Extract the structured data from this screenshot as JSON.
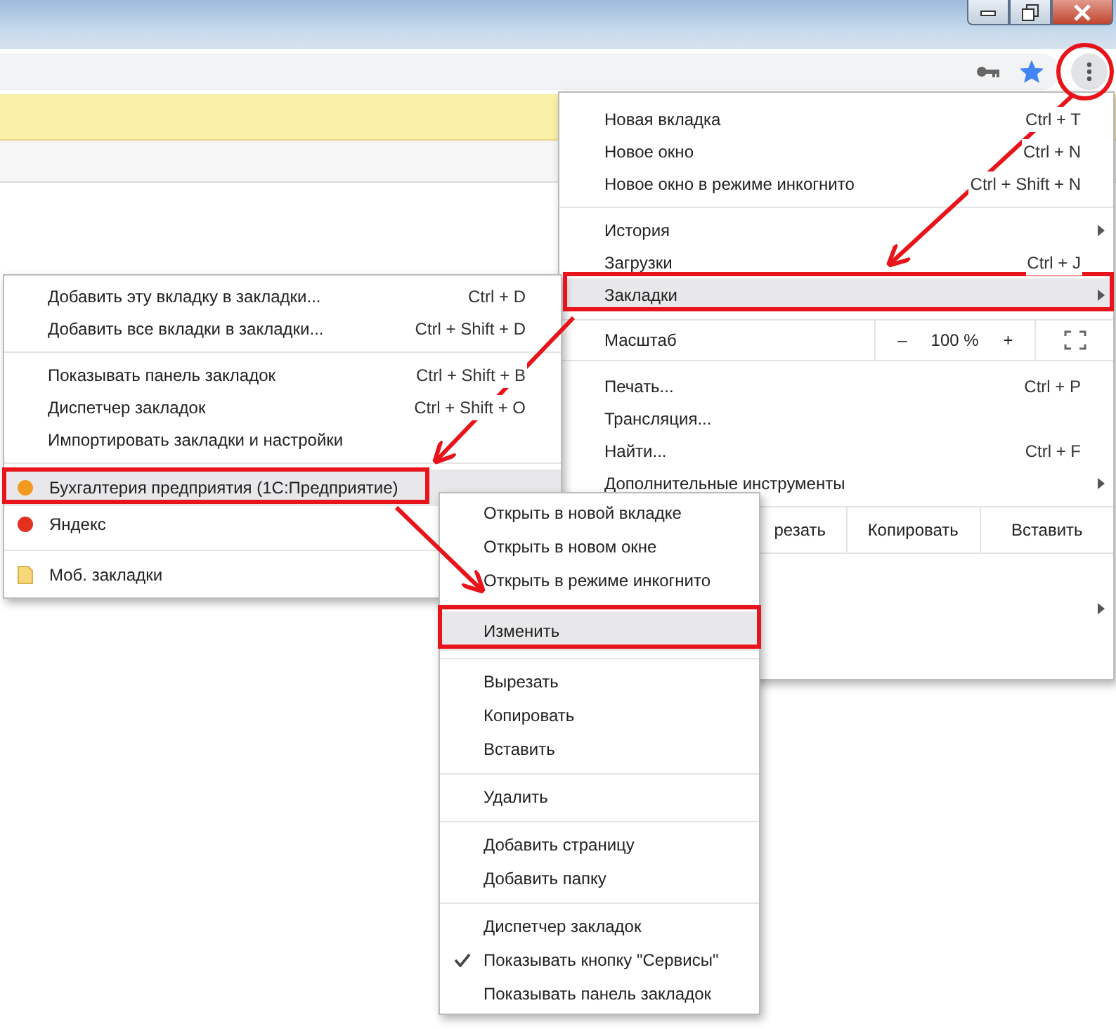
{
  "toolbar": {
    "bookmarked": true
  },
  "main_menu": [
    {
      "kind": "item",
      "label": "Новая вкладка",
      "shortcut": "Ctrl + T",
      "highlighted": false
    },
    {
      "kind": "item",
      "label": "Новое окно",
      "shortcut": "Ctrl + N",
      "highlighted": false
    },
    {
      "kind": "item",
      "label": "Новое окно в режиме инкогнито",
      "shortcut": "Ctrl + Shift + N",
      "highlighted": false
    },
    {
      "kind": "separator"
    },
    {
      "kind": "item",
      "label": "История",
      "has_submenu": true,
      "highlighted": false
    },
    {
      "kind": "item",
      "label": "Загрузки",
      "shortcut": "Ctrl + J",
      "highlighted": false
    },
    {
      "kind": "item",
      "label": "Закладки",
      "has_submenu": true,
      "highlighted": true
    },
    {
      "kind": "zoom",
      "label": "Масштаб",
      "minus": "–",
      "value": "100 %",
      "plus": "+"
    },
    {
      "kind": "item",
      "label": "Печать...",
      "shortcut": "Ctrl + P",
      "highlighted": false
    },
    {
      "kind": "item",
      "label": "Трансляция...",
      "highlighted": false
    },
    {
      "kind": "item",
      "label": "Найти...",
      "shortcut": "Ctrl + F",
      "highlighted": false
    },
    {
      "kind": "item",
      "label": "Дополнительные инструменты",
      "has_submenu": true,
      "highlighted": false
    },
    {
      "kind": "edit",
      "cells": [
        "резать",
        "Копировать",
        "Вставить"
      ]
    },
    {
      "kind": "item",
      "has_submenu": true,
      "highlighted": false
    }
  ],
  "bookmarks_menu": [
    {
      "kind": "item",
      "label": "Добавить эту вкладку в закладки...",
      "shortcut": "Ctrl + D",
      "highlighted": false
    },
    {
      "kind": "item",
      "label": "Добавить все вкладки в закладки...",
      "shortcut": "Ctrl + Shift + D",
      "highlighted": false
    },
    {
      "kind": "separator"
    },
    {
      "kind": "item",
      "label": "Показывать панель закладок",
      "shortcut": "Ctrl + Shift + B",
      "highlighted": false
    },
    {
      "kind": "item",
      "label": "Диспетчер закладок",
      "shortcut": "Ctrl + Shift + O",
      "highlighted": false
    },
    {
      "kind": "item",
      "label": "Импортировать закладки и настройки",
      "highlighted": false
    },
    {
      "kind": "separator"
    },
    {
      "kind": "link",
      "label": "Бухгалтерия предприятия (1С:Предприятие)",
      "color": "#f29a1f",
      "highlighted": true
    },
    {
      "kind": "link",
      "label": "Яндекс",
      "color": "#e3301f",
      "highlighted": false
    },
    {
      "kind": "separator"
    },
    {
      "kind": "folder",
      "label": "Моб. закладки",
      "highlighted": false
    }
  ],
  "context_menu": [
    {
      "kind": "item",
      "label": "Открыть в новой вкладке",
      "highlighted": false,
      "checked": false
    },
    {
      "kind": "item",
      "label": "Открыть в новом окне",
      "highlighted": false,
      "checked": false
    },
    {
      "kind": "item",
      "label": "Открыть в режиме инкогнито",
      "highlighted": false,
      "checked": false
    },
    {
      "kind": "separator"
    },
    {
      "kind": "item",
      "label": "Изменить",
      "highlighted": true,
      "checked": false
    },
    {
      "kind": "separator"
    },
    {
      "kind": "item",
      "label": "Вырезать",
      "highlighted": false,
      "checked": false
    },
    {
      "kind": "item",
      "label": "Копировать",
      "highlighted": false,
      "checked": false
    },
    {
      "kind": "item",
      "label": "Вставить",
      "highlighted": false,
      "checked": false
    },
    {
      "kind": "separator"
    },
    {
      "kind": "item",
      "label": "Удалить",
      "highlighted": false,
      "checked": false
    },
    {
      "kind": "separator"
    },
    {
      "kind": "item",
      "label": "Добавить страницу",
      "highlighted": false,
      "checked": false
    },
    {
      "kind": "item",
      "label": "Добавить папку",
      "highlighted": false,
      "checked": false
    },
    {
      "kind": "separator"
    },
    {
      "kind": "item",
      "label": "Диспетчер закладок",
      "highlighted": false,
      "checked": false
    },
    {
      "kind": "item",
      "label": "Показывать кнопку \"Сервисы\"",
      "highlighted": false,
      "checked": true
    },
    {
      "kind": "item",
      "label": "Показывать панель закладок",
      "highlighted": false,
      "checked": false
    }
  ]
}
